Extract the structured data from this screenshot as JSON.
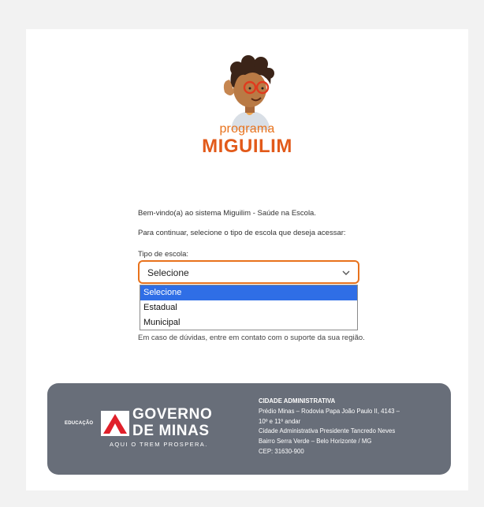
{
  "brand": {
    "subtitle": "programa",
    "title": "MIGUILIM",
    "colors": {
      "orange": "#e8721c",
      "accent": "#e25a1a"
    }
  },
  "intro": {
    "welcome": "Bem-vindo(a) ao sistema Miguilim - Saúde na Escola.",
    "instruction": "Para continuar, selecione o tipo de escola que deseja acessar:"
  },
  "form": {
    "label": "Tipo de escola:",
    "selected": "Selecione",
    "options": [
      "Selecione",
      "Estadual",
      "Municipal"
    ]
  },
  "help": {
    "text": "Em caso de dúvidas, entre em contato com o suporte da sua região."
  },
  "footer": {
    "edu_label": "EDUCAÇÃO",
    "gov_line1": "GOVERNO",
    "gov_line2": "DE MINAS",
    "slogan": "AQUI O TREM PROSPERA.",
    "address_title": "CIDADE ADMINISTRATIVA",
    "address_lines": [
      "Prédio Minas – Rodovia Papa João Paulo II, 4143 –",
      "10º e 11º andar",
      "Cidade Administrativa Presidente Tancredo Neves",
      "Bairro Serra Verde – Belo Horizonte / MG",
      "CEP: 31630-900"
    ],
    "colors": {
      "background": "#686e79",
      "logo_red": "#e0202a"
    }
  },
  "icons": {
    "logo": "child-listening-icon",
    "chevron": "chevron-down-icon"
  }
}
